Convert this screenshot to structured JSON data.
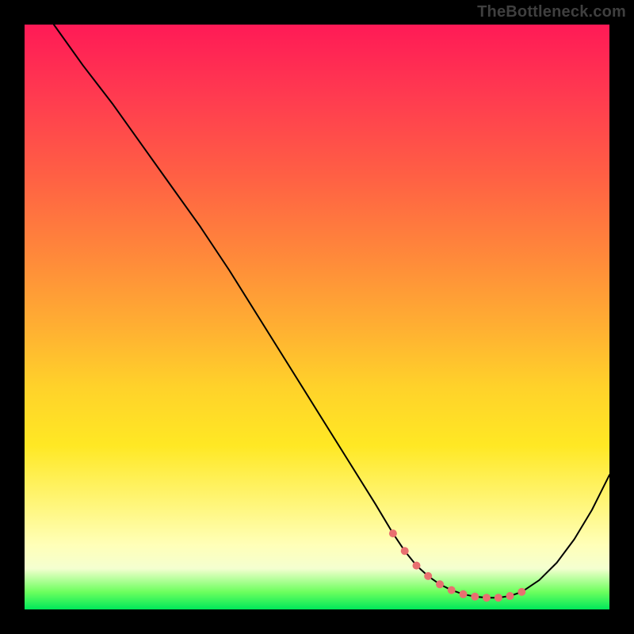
{
  "watermark": "TheBottleneck.com",
  "colors": {
    "page_bg": "#000000",
    "gradient_top": "#ff1a56",
    "gradient_bottom": "#00e85a",
    "curve": "#000000",
    "markers": "#e87070",
    "watermark": "#3f3f3f"
  },
  "chart_data": {
    "type": "line",
    "title": "",
    "xlabel": "",
    "ylabel": "",
    "xlim": [
      0,
      100
    ],
    "ylim": [
      0,
      100
    ],
    "grid": false,
    "legend": false,
    "series": [
      {
        "name": "bottleneck-curve",
        "x": [
          5,
          10,
          15,
          20,
          25,
          30,
          35,
          40,
          45,
          50,
          55,
          60,
          63,
          65,
          67,
          69,
          71,
          73,
          75,
          77,
          79,
          81,
          83,
          85,
          88,
          91,
          94,
          97,
          100
        ],
        "values": [
          100,
          93,
          86.5,
          79.5,
          72.5,
          65.5,
          58,
          50,
          42,
          34,
          26,
          18,
          13,
          10,
          7.5,
          5.7,
          4.3,
          3.3,
          2.6,
          2.2,
          2.0,
          2.0,
          2.3,
          3.0,
          5.0,
          8.0,
          12,
          17,
          23
        ]
      }
    ],
    "markers": {
      "name": "highlight-points",
      "x": [
        63,
        65,
        67,
        69,
        71,
        73,
        75,
        77,
        79,
        81,
        83,
        85
      ],
      "values": [
        13,
        10,
        7.5,
        5.7,
        4.3,
        3.3,
        2.6,
        2.2,
        2.0,
        2.0,
        2.3,
        3.0
      ]
    }
  }
}
